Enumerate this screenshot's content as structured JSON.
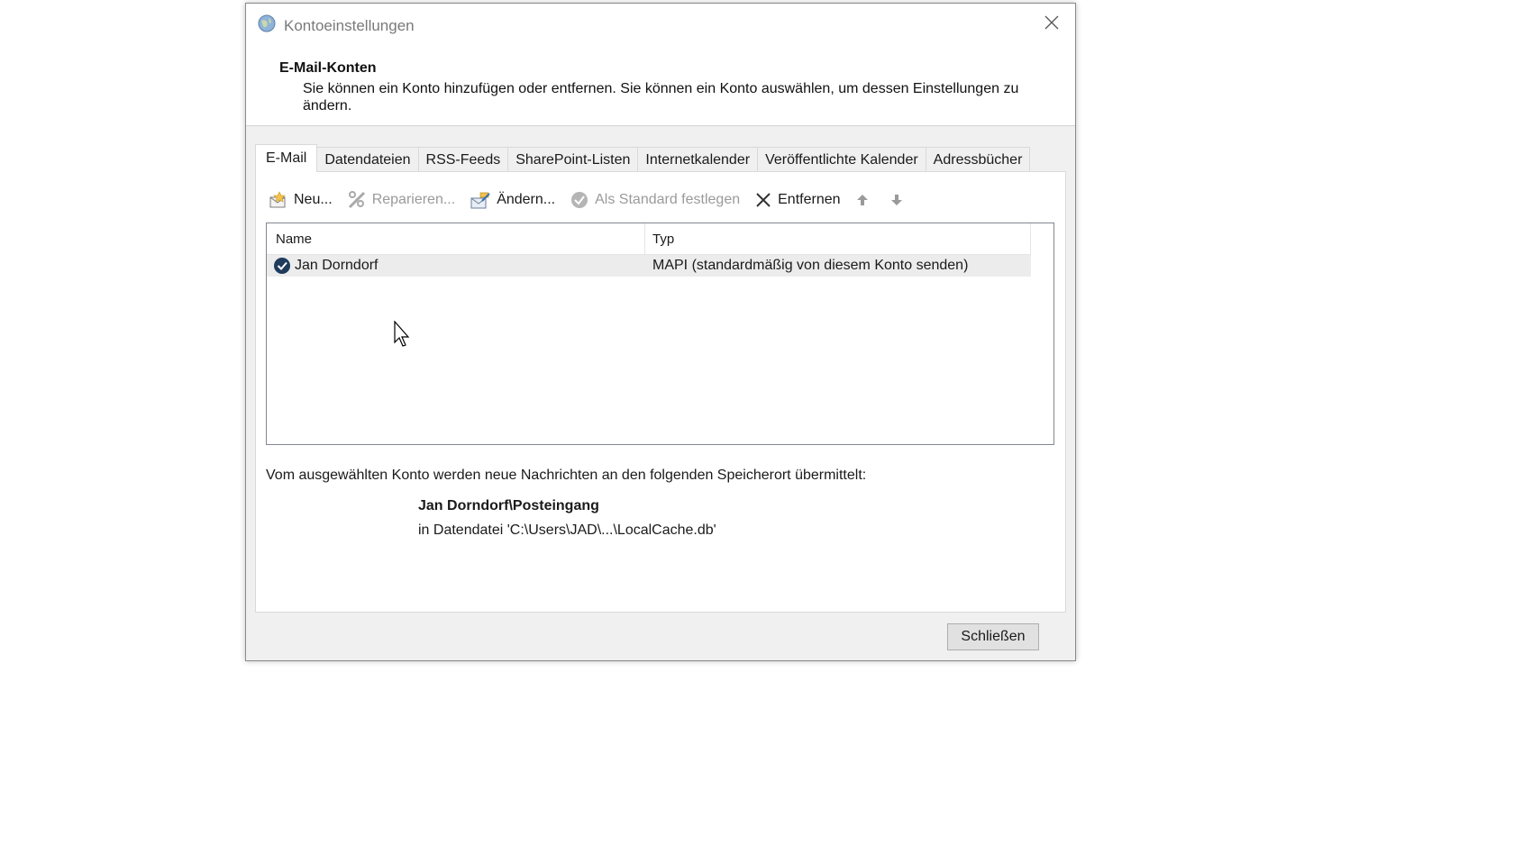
{
  "window": {
    "title": "Kontoeinstellungen"
  },
  "header": {
    "title": "E-Mail-Konten",
    "description": "Sie können ein Konto hinzufügen oder entfernen. Sie können ein Konto auswählen, um dessen Einstellungen zu ändern."
  },
  "tabs": [
    {
      "label": "E-Mail",
      "active": true
    },
    {
      "label": "Datendateien"
    },
    {
      "label": "RSS-Feeds"
    },
    {
      "label": "SharePoint-Listen"
    },
    {
      "label": "Internetkalender"
    },
    {
      "label": "Veröffentlichte Kalender"
    },
    {
      "label": "Adressbücher"
    }
  ],
  "toolbar": {
    "new_label": "Neu...",
    "repair_label": "Reparieren...",
    "change_label": "Ändern...",
    "default_label": "Als Standard festlegen",
    "remove_label": "Entfernen",
    "move_up_icon": "arrow-up-icon",
    "move_down_icon": "arrow-down-icon"
  },
  "list": {
    "columns": [
      "Name",
      "Typ"
    ],
    "rows": [
      {
        "name": "Jan Dorndorf",
        "type": "MAPI (standardmäßig von diesem Konto senden)",
        "icon": "default-check-icon"
      }
    ]
  },
  "info": {
    "text": "Vom ausgewählten Konto werden neue Nachrichten an den folgenden Speicherort übermittelt:",
    "folder": "Jan Dorndorf\\Posteingang",
    "file": "in Datendatei 'C:\\Users\\JAD\\...\\LocalCache.db'"
  },
  "footer": {
    "close_label": "Schließen"
  },
  "colors": {
    "dialog_bg": "#f0f0f0",
    "accent": "#1f4e79",
    "disabled": "#9a9a9a"
  }
}
